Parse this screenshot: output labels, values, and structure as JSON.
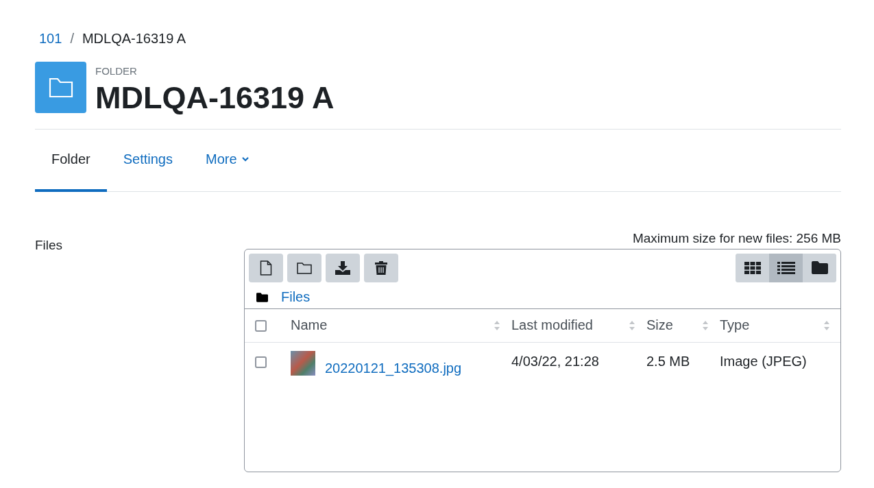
{
  "breadcrumb": [
    {
      "label": "101",
      "kind": "link"
    },
    {
      "label": "/",
      "kind": "separator"
    },
    {
      "label": "MDLQA-16319 A",
      "kind": "current"
    }
  ],
  "header": {
    "kicker": "FOLDER",
    "title": "MDLQA-16319 A"
  },
  "tabs": [
    {
      "label": "Folder",
      "selected": true,
      "dropdown": false
    },
    {
      "label": "Settings",
      "selected": false,
      "dropdown": false
    },
    {
      "label": "More",
      "selected": false,
      "dropdown": true
    }
  ],
  "files_label": "Files",
  "max_size": "Maximum size for new files: 256 MB",
  "toolbar": [
    {
      "kind": "add-file"
    },
    {
      "kind": "new-folder"
    },
    {
      "kind": "download"
    },
    {
      "kind": "delete"
    }
  ],
  "view_modes": [
    {
      "kind": "icons",
      "selected": false
    },
    {
      "kind": "list",
      "selected": true
    },
    {
      "kind": "tree",
      "selected": false
    }
  ],
  "path": "Files",
  "table": {
    "select_all": {
      "checked": false
    },
    "columns": [
      "Name",
      "Last modified",
      "Size",
      "Type"
    ],
    "rows": [
      {
        "checked": false,
        "name": "20220121_135308.jpg",
        "modified": "4/03/22, 21:28",
        "size": "2.5 MB",
        "type": "Image (JPEG)"
      }
    ]
  }
}
